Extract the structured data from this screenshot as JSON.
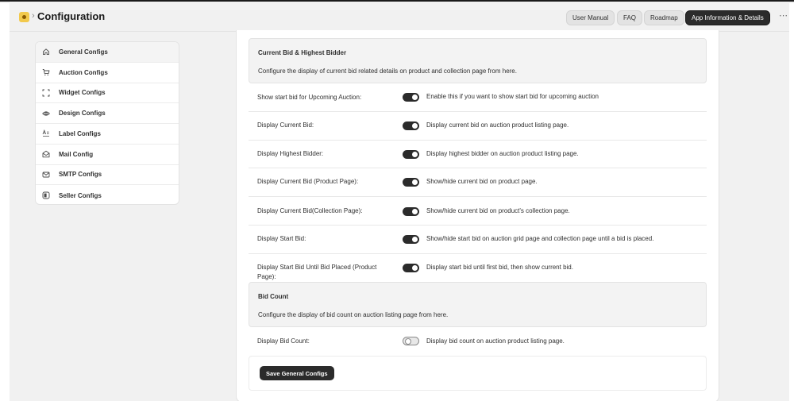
{
  "header": {
    "title": "Configuration",
    "breadcrumb_separator": "›",
    "buttons": {
      "user_manual": "User Manual",
      "faq": "FAQ",
      "roadmap": "Roadmap",
      "app_info": "App Information & Details"
    },
    "more_icon": "⋯"
  },
  "sidebar": {
    "items": [
      {
        "label": "General Configs",
        "icon": "home-icon",
        "active": true
      },
      {
        "label": "Auction Configs",
        "icon": "cart-icon",
        "active": false
      },
      {
        "label": "Widget Configs",
        "icon": "frame-icon",
        "active": false
      },
      {
        "label": "Design Configs",
        "icon": "eye-icon",
        "active": false
      },
      {
        "label": "Label Configs",
        "icon": "text-icon",
        "active": false
      },
      {
        "label": "Mail Config",
        "icon": "mail-icon",
        "active": false
      },
      {
        "label": "SMTP Configs",
        "icon": "envelope-icon",
        "active": false
      },
      {
        "label": "Seller Configs",
        "icon": "seller-icon",
        "active": false
      }
    ]
  },
  "current_bid_section": {
    "title": "Current Bid & Highest Bidder",
    "description": "Configure the display of current bid related details on product and collection page from here.",
    "rows": [
      {
        "label": "Show start bid for Upcoming Auction:",
        "enabled": true,
        "description": "Enable this if you want to show start bid for upcoming auction"
      },
      {
        "label": "Display Current Bid:",
        "enabled": true,
        "description": "Display current bid on auction product listing page."
      },
      {
        "label": "Display Highest Bidder:",
        "enabled": true,
        "description": "Display highest bidder on auction product listing page."
      },
      {
        "label": "Display Current Bid (Product Page):",
        "enabled": true,
        "description": "Show/hide current bid on product page."
      },
      {
        "label": "Display Current Bid(Collection Page):",
        "enabled": true,
        "description": "Show/hide current bid on product's collection page."
      },
      {
        "label": "Display Start Bid:",
        "enabled": true,
        "description": "Show/hide start bid on auction grid page and collection page until a bid is placed."
      },
      {
        "label": "Display Start Bid Until Bid Placed (Product Page):",
        "enabled": true,
        "description": "Display start bid until first bid, then show current bid."
      }
    ]
  },
  "bid_count_section": {
    "title": "Bid Count",
    "description": "Configure the display of bid count on auction listing page from here.",
    "rows": [
      {
        "label": "Display Bid Count:",
        "enabled": false,
        "description": "Display bid count on auction product listing page."
      }
    ]
  },
  "save_button": "Save General Configs",
  "colors": {
    "page_bg": "#f1f1f1",
    "toggle_on": "#2b2b2b",
    "primary_button": "#2b2b2b",
    "app_icon": "#f2c94c"
  }
}
